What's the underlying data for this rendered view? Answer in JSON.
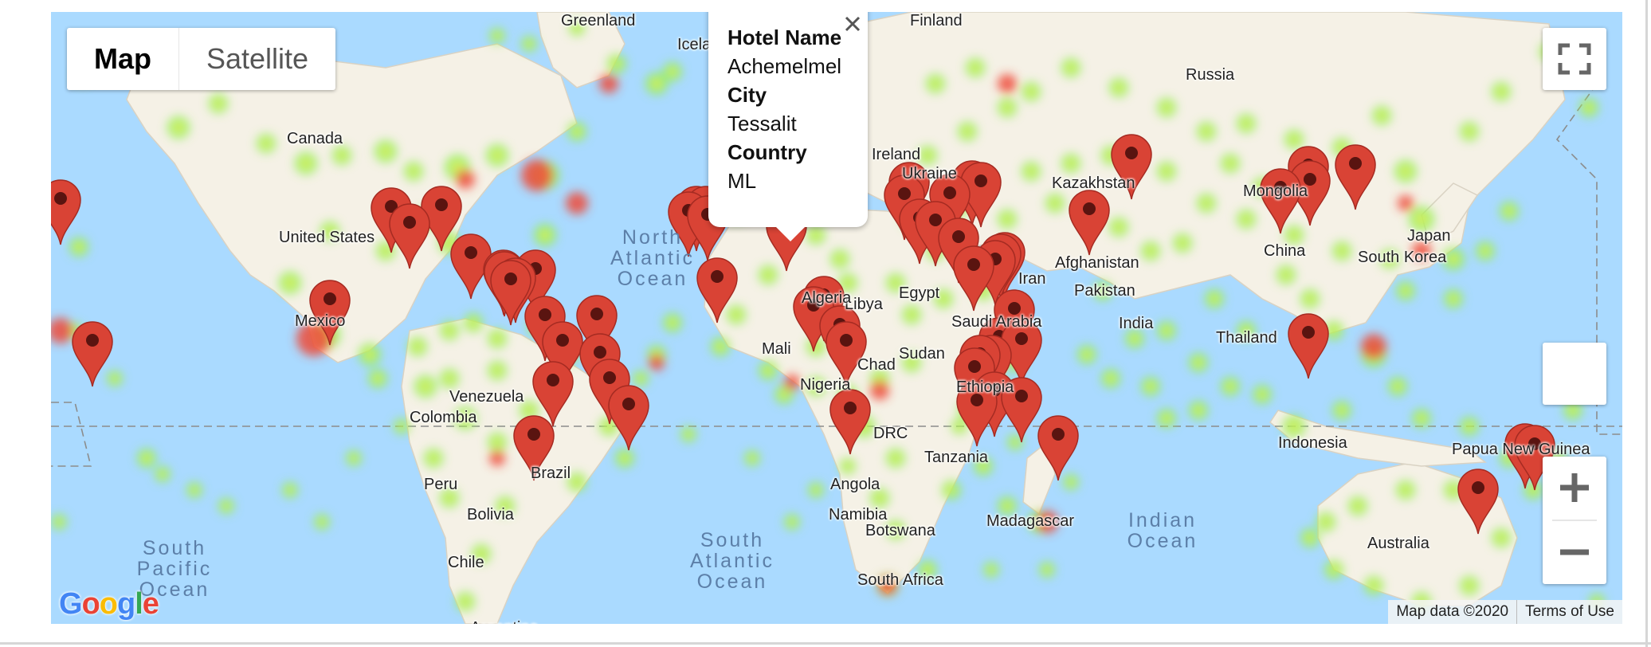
{
  "map_controls": {
    "map_type": {
      "map_label": "Map",
      "satellite_label": "Satellite",
      "selected": "Map"
    },
    "icons": {
      "fullscreen": "fullscreen-icon",
      "zoom_in": "plus-icon",
      "zoom_out": "minus-icon",
      "close": "close-icon",
      "marker": "map-marker-icon"
    }
  },
  "info_window": {
    "fields": [
      {
        "label": "Hotel Name",
        "value": "Achemelmel"
      },
      {
        "label": "City",
        "value": "Tessalit"
      },
      {
        "label": "Country",
        "value": "ML"
      }
    ]
  },
  "labels": {
    "continents_countries": [
      "Canada",
      "United States",
      "Mexico",
      "Colombia",
      "Venezuela",
      "Peru",
      "Brazil",
      "Bolivia",
      "Chile",
      "Argentina",
      "Russia",
      "Ukraine",
      "Kazakhstan",
      "Mongolia",
      "China",
      "South Korea",
      "Japan",
      "Afghanistan",
      "Pakistan",
      "India",
      "Iran",
      "Thailand",
      "Indonesia",
      "Papua New Guinea",
      "Australia",
      "Libya",
      "Egypt",
      "Saudi Arabia",
      "Mali",
      "Chad",
      "Sudan",
      "Nigeria",
      "DRC",
      "Tanzania",
      "Angola",
      "Namibia",
      "Botswana",
      "Madagascar",
      "South Africa",
      "Ethiopia",
      "Algeria",
      "Finland",
      "Iceland",
      "Ireland",
      "Greenland"
    ],
    "oceans": [
      {
        "lines": [
          "North",
          "Atlantic",
          "Ocean"
        ]
      },
      {
        "lines": [
          "South",
          "Atlantic",
          "Ocean"
        ]
      },
      {
        "lines": [
          "Indian",
          "Ocean"
        ]
      },
      {
        "lines": [
          "South",
          "Pacific",
          "Ocean"
        ]
      }
    ]
  },
  "footer": {
    "logo_text": "Google",
    "map_data": "Map data ©2020",
    "terms": "Terms of Use"
  },
  "colors": {
    "water": "#aadaff",
    "land": "#f5f1e6",
    "marker_red": "#d94335",
    "marker_stroke": "#a52b22",
    "heat_green": "#90ee5a",
    "heat_yellow": "#f2ef5a",
    "heat_red": "#ef4a3a",
    "google_blue": "#4285f4",
    "google_red": "#ea4335",
    "google_yellow": "#fbbc05",
    "google_green": "#34a853"
  }
}
